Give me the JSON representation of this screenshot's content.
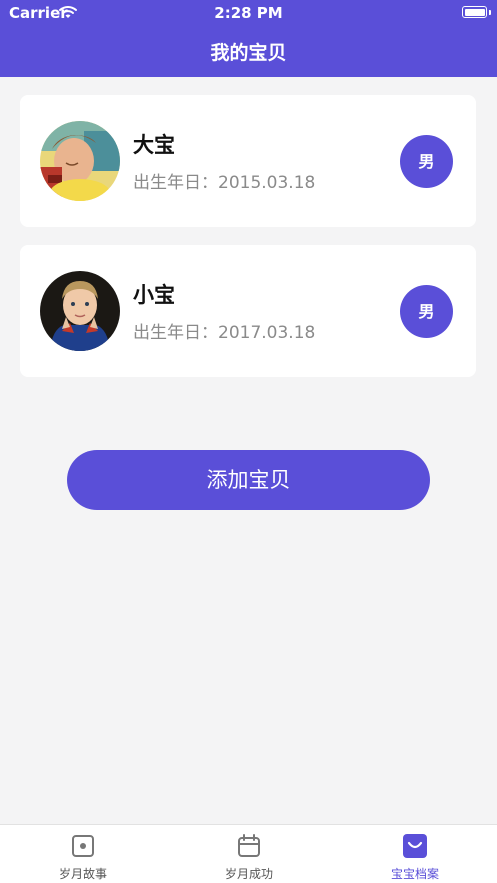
{
  "status_bar": {
    "carrier": "Carrier",
    "time": "2:28 PM"
  },
  "nav": {
    "title": "我的宝贝"
  },
  "babies": [
    {
      "name": "大宝",
      "birth": "出生年日：2015.03.18",
      "gender": "男"
    },
    {
      "name": "小宝",
      "birth": "出生年日：2017.03.18",
      "gender": "男"
    }
  ],
  "add_button": {
    "label": "添加宝贝"
  },
  "tabbar": {
    "items": [
      {
        "label": "岁月故事",
        "icon": "story-icon",
        "active": false
      },
      {
        "label": "岁月成功",
        "icon": "calendar-icon",
        "active": false
      },
      {
        "label": "宝宝档案",
        "icon": "baby-profile-icon",
        "active": true
      }
    ]
  },
  "colors": {
    "accent": "#5a4fd8",
    "background": "#f4f4f5",
    "card": "#ffffff",
    "secondary_text": "#8a8a8a"
  }
}
